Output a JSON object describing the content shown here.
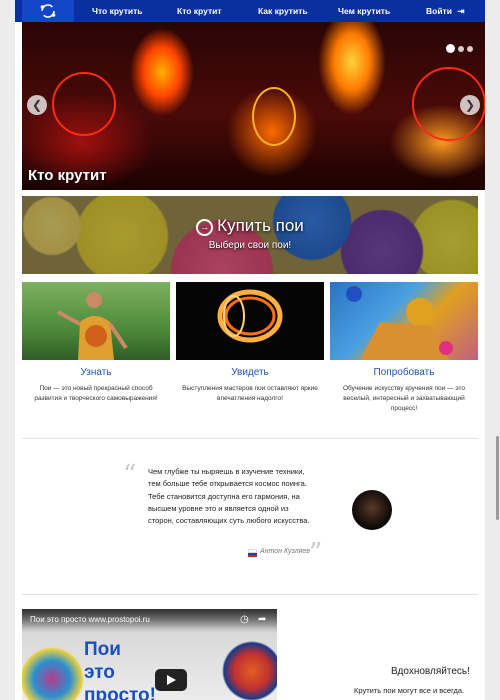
{
  "nav": {
    "items": [
      "Что крутить",
      "Кто крутит",
      "Как крутить",
      "Чем крутить"
    ],
    "login": "Войти",
    "login_icon": "sign-in-icon",
    "logo_icon": "poi-logo-icon"
  },
  "hero": {
    "title": "Кто крутит",
    "slide_count": 3,
    "active_slide": 1
  },
  "banner": {
    "title": "Купить пои",
    "subtitle": "Выбери свои пои!",
    "icon": "arrow-circle-icon"
  },
  "features": [
    {
      "title": "Узнать",
      "text": "Пои — это новый прекрасный способ развития и творческого самовыражения!"
    },
    {
      "title": "Увидеть",
      "text": "Выступления мастеров пои оставляют яркие впечатления надолго!"
    },
    {
      "title": "Попробовать",
      "text": "Обучение искусству кручения пои — это веселый, интересный и захватывающий процесс!"
    }
  ],
  "quote": {
    "text": "Чем глубже ты ныряешь в изучение техники, тем больше тебе открывается космос поинга. Тебе становится доступна его гармония, на высшем уровне это и является одной из сторон, составляющих суть любого искусства.",
    "author": "Антон Кузляев"
  },
  "video": {
    "title": "Пои это просто www.prostopoi.ru",
    "overlay_text": "Пои\nэто\nпросто!"
  },
  "inspire": {
    "title": "Вдохновляйтесь!",
    "text": "Крутить пои могут все и всегда."
  },
  "colors": {
    "nav_bg": "#0a2f9e",
    "logo_bg": "#1246c7",
    "link": "#1c55b0"
  }
}
